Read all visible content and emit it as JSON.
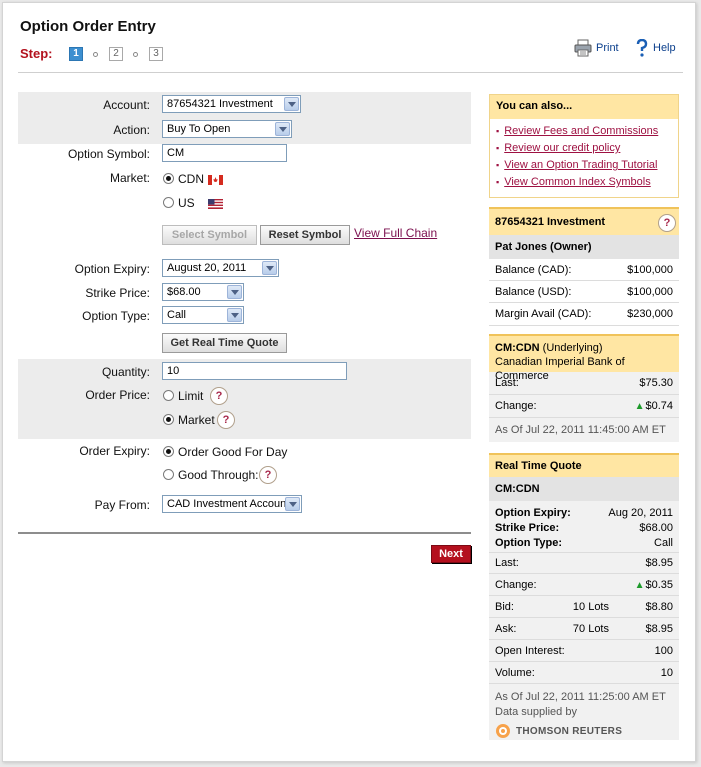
{
  "page": {
    "title": "Option Order Entry",
    "step_label": "Step:"
  },
  "steps": [
    "1",
    "2",
    "3"
  ],
  "toolbar": {
    "print": "Print",
    "help": "Help"
  },
  "form": {
    "account_label": "Account:",
    "account_value": "87654321 Investment",
    "action_label": "Action:",
    "action_value": "Buy To Open",
    "symbol_label": "Option Symbol:",
    "symbol_value": "CM",
    "market_label": "Market:",
    "market_cdn": "CDN",
    "market_us": "US",
    "select_symbol": "Select Symbol",
    "reset_symbol": "Reset Symbol",
    "view_full_chain": "View Full Chain",
    "expiry_label": "Option Expiry:",
    "expiry_value": "August 20, 2011",
    "strike_label": "Strike Price:",
    "strike_value": "$68.00",
    "type_label": "Option Type:",
    "type_value": "Call",
    "get_quote": "Get Real Time Quote",
    "quantity_label": "Quantity:",
    "quantity_value": "10",
    "order_price_label": "Order Price:",
    "limit": "Limit",
    "market": "Market",
    "order_expiry_label": "Order Expiry:",
    "good_for_day": "Order Good For Day",
    "good_through": "Good Through:",
    "pay_from_label": "Pay From:",
    "pay_from_value": "CAD Investment Account",
    "next": "Next"
  },
  "help_glyph": "?",
  "sidebar": {
    "also": {
      "title": "You can also...",
      "links": [
        "Review Fees and Commissions",
        "Review our credit policy",
        "View an Option Trading Tutorial",
        "View Common Index Symbols"
      ]
    },
    "account": {
      "title": "87654321 Investment",
      "owner": "Pat Jones (Owner)",
      "rows": [
        {
          "label": "Balance (CAD):",
          "value": "$100,000"
        },
        {
          "label": "Balance (USD):",
          "value": "$100,000"
        },
        {
          "label": "Margin Avail (CAD):",
          "value": "$230,000"
        }
      ]
    },
    "underlying": {
      "title": "CM:CDN",
      "title_suffix": "(Underlying)",
      "name": "Canadian Imperial Bank of Commerce",
      "last_label": "Last:",
      "last_value": "$75.30",
      "change_label": "Change:",
      "change_value": "$0.74",
      "asof": "As Of Jul 22, 2011 11:45:00 AM ET"
    },
    "quote": {
      "title": "Real Time Quote",
      "symbol": "CM:CDN",
      "expiry_label": "Option Expiry:",
      "expiry_value": "Aug 20, 2011",
      "strike_label": "Strike Price:",
      "strike_value": "$68.00",
      "type_label": "Option Type:",
      "type_value": "Call",
      "last_label": "Last:",
      "last_value": "$8.95",
      "change_label": "Change:",
      "change_value": "$0.35",
      "bid_label": "Bid:",
      "bid_lots": "10 Lots",
      "bid_value": "$8.80",
      "ask_label": "Ask:",
      "ask_lots": "70 Lots",
      "ask_value": "$8.95",
      "oi_label": "Open Interest:",
      "oi_value": "100",
      "vol_label": "Volume:",
      "vol_value": "10",
      "asof": "As Of Jul 22, 2011 11:25:00 AM ET",
      "supplied": "Data supplied by",
      "provider": "THOMSON REUTERS"
    }
  },
  "colors": {
    "accent_red": "#b4101e",
    "step_active": "#3d8fd0",
    "sidebar_header": "#ffe6a3"
  }
}
